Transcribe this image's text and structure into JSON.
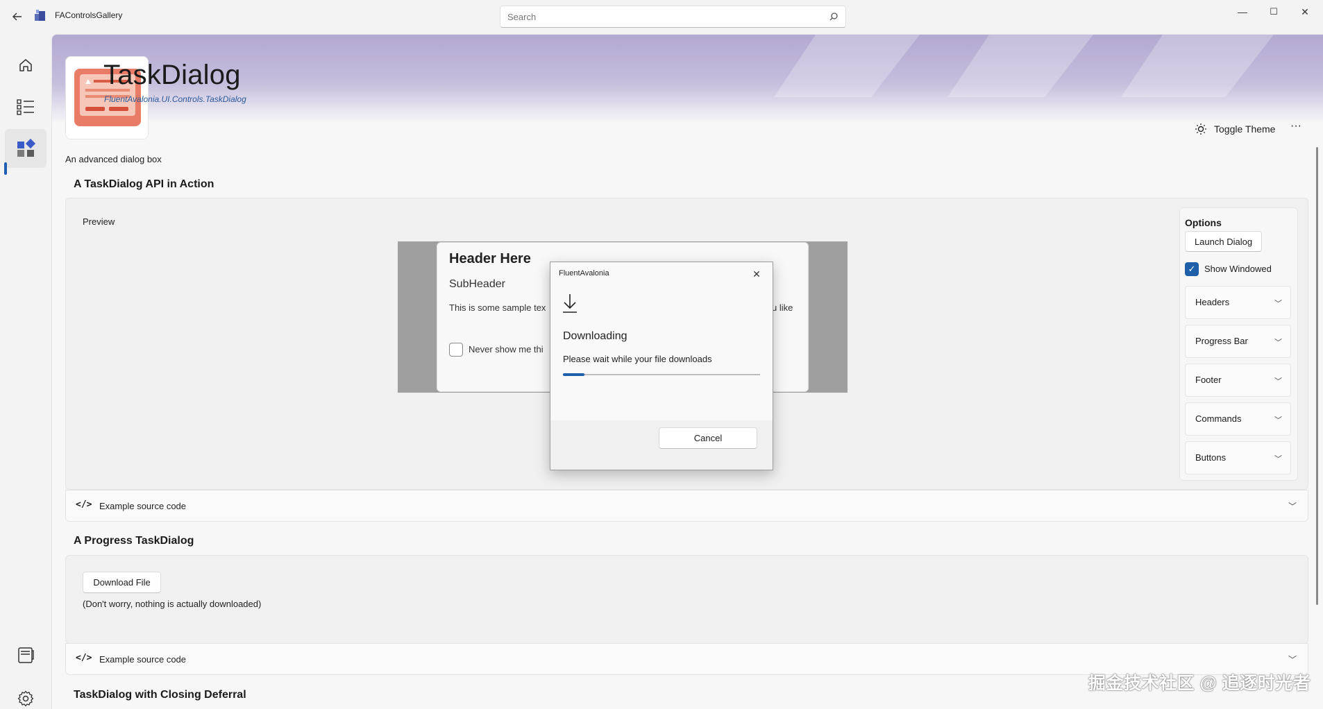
{
  "titlebar": {
    "app_name": "FAControlsGallery",
    "search_placeholder": "Search",
    "minimize": "—",
    "maximize": "☐",
    "close": "✕"
  },
  "nav": {
    "items": [
      {
        "icon": "home-icon"
      },
      {
        "icon": "list-icon"
      },
      {
        "icon": "controls-icon",
        "selected": true
      }
    ],
    "bottom_items": [
      {
        "icon": "book-icon"
      },
      {
        "icon": "gear-icon"
      }
    ]
  },
  "header": {
    "title": "TaskDialog",
    "subtitle": "FluentAvalonia.UI.Controls.TaskDialog",
    "toggle_theme": "Toggle Theme",
    "more": "···",
    "description": "An advanced dialog box"
  },
  "section1": {
    "title": "A TaskDialog API in Action",
    "preview_label": "Preview",
    "dialog1": {
      "header": "Header Here",
      "subheader": "SubHeader",
      "text": "This is some sample tex",
      "text_right": "u like",
      "checkbox_label": "Never show me thi"
    },
    "dialog2": {
      "title": "FluentAvalonia",
      "close": "✕",
      "heading": "Downloading",
      "text": "Please wait while your file downloads",
      "progress": 0.11,
      "cancel": "Cancel"
    },
    "options": {
      "title": "Options",
      "launch_button": "Launch Dialog",
      "show_windowed": "Show Windowed",
      "show_windowed_checked": true,
      "expanders": [
        "Headers",
        "Progress Bar",
        "Footer",
        "Commands",
        "Buttons"
      ]
    },
    "source_label": "Example source code",
    "source_icon": "</>"
  },
  "section2": {
    "title": "A Progress TaskDialog",
    "button": "Download File",
    "note": "(Don't worry, nothing is actually downloaded)",
    "source_label": "Example source code",
    "source_icon": "</>"
  },
  "section3": {
    "title": "TaskDialog with Closing Deferral"
  },
  "watermark": "掘金技术社区 @ 追逐时光者",
  "colors": {
    "accent": "#1d5fa8",
    "banner": "#b3a9d1"
  }
}
